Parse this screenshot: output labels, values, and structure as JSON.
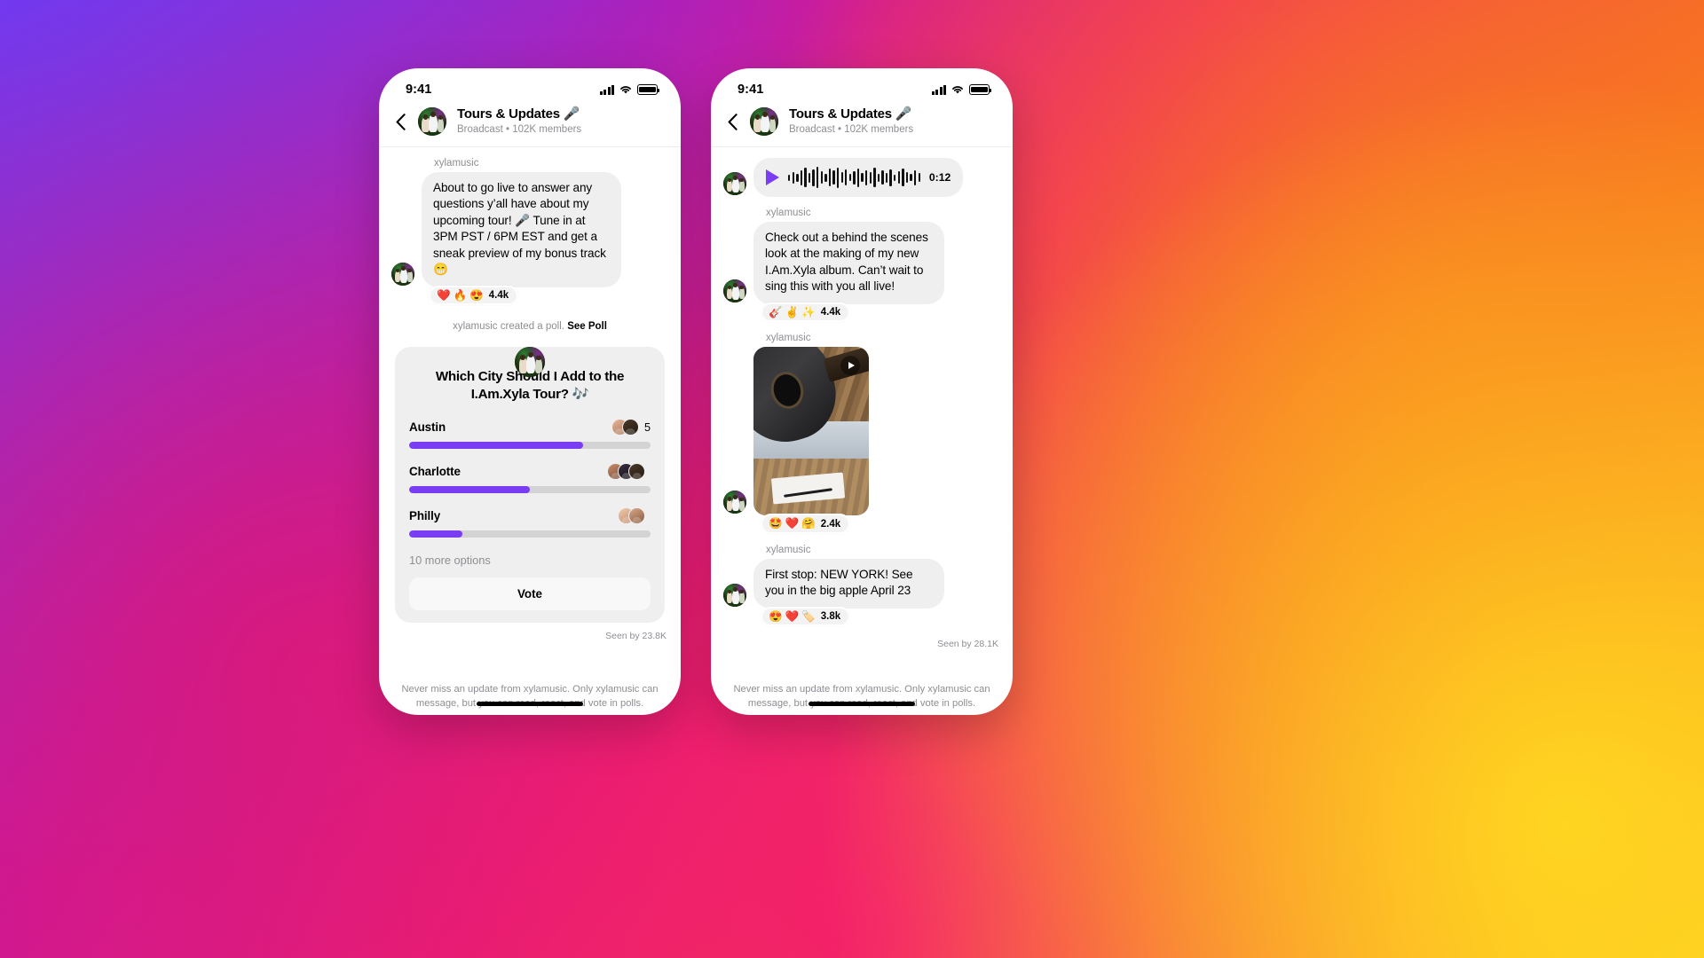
{
  "background": {
    "colors": [
      "#7B35F0",
      "#C317A8",
      "#F01E6E",
      "#F7711F",
      "#FFD521"
    ]
  },
  "accent": {
    "purple": "#7B3DF3",
    "track": "#d3d3d3",
    "bubble": "#efefef"
  },
  "status_bar": {
    "time": "9:41",
    "signal_icon": "cellular-signal-icon",
    "wifi_icon": "wifi-icon",
    "battery_icon": "battery-icon"
  },
  "header": {
    "back_icon": "back-chevron-icon",
    "avatar": "group-avatar",
    "title": "Tours & Updates 🎤",
    "subtitle": "Broadcast • 102K members"
  },
  "left_phone": {
    "sender": "xylamusic",
    "message": "About to go live to answer any questions y’all have about my upcoming tour! 🎤 Tune in at 3PM PST / 6PM EST and get a sneak preview of my bonus track 😁",
    "reactions": {
      "emojis": [
        "❤️",
        "🔥",
        "😍"
      ],
      "count": "4.4k"
    },
    "poll_note_prefix": "xylamusic created a poll.",
    "poll_note_link": "See Poll",
    "poll": {
      "question": "Which City Should I Add to the I.Am.Xyla Tour? 🎶",
      "options": [
        {
          "label": "Austin",
          "count": "5",
          "percent": 72,
          "voters": 2
        },
        {
          "label": "Charlotte",
          "count": "",
          "percent": 50,
          "voters": 3
        },
        {
          "label": "Philly",
          "count": "",
          "percent": 22,
          "voters": 2
        }
      ],
      "more_options": "10 more options",
      "vote_button": "Vote"
    },
    "seen_by": "Seen by 23.8K",
    "footer": "Never miss an update from xylamusic. Only xylamusic can message, but you can read, react, and vote in polls."
  },
  "right_phone": {
    "voice_note": {
      "play_icon": "play-icon",
      "duration": "0:12"
    },
    "messages": [
      {
        "sender": "xylamusic",
        "text": "Check out a behind the scenes look at the making of my new I.Am.Xyla album. Can’t wait to sing this with you all live!",
        "reactions": {
          "emojis": [
            "🎸",
            "✌️",
            "✨"
          ],
          "count": "4.4k"
        }
      },
      {
        "sender": "xylamusic",
        "media": "guitar-desk-photo",
        "play_icon": "play-icon",
        "reactions": {
          "emojis": [
            "🤩",
            "❤️",
            "🤗"
          ],
          "count": "2.4k"
        }
      },
      {
        "sender": "xylamusic",
        "text": "First stop: NEW YORK! See you in the big apple April 23",
        "reactions": {
          "emojis": [
            "😍",
            "❤️",
            "🏷️"
          ],
          "count": "3.8k"
        }
      }
    ],
    "seen_by": "Seen by 28.1K",
    "footer": "Never miss an update from xylamusic. Only xylamusic can message, but you can read, react, and vote in polls."
  }
}
